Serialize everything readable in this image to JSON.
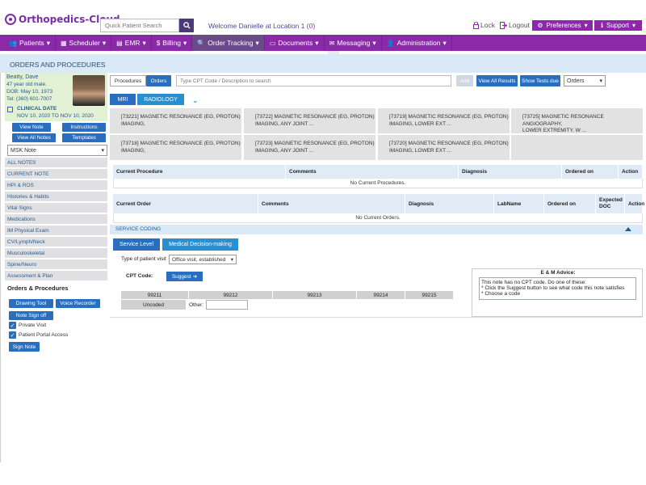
{
  "app": {
    "name": "Orthopedics-Cloud"
  },
  "header": {
    "search_placeholder": "Quick Patient Search",
    "welcome_prefix": "Welcome Danielle at Location 1 (",
    "welcome_count": "0",
    "welcome_suffix": ")",
    "lock_label": "Lock",
    "logout_label": "Logout",
    "preferences_label": "Preferences",
    "support_label": "Support"
  },
  "nav": {
    "items": [
      {
        "label": "Patients"
      },
      {
        "label": "Scheduler"
      },
      {
        "label": "EMR"
      },
      {
        "label": "Billing"
      },
      {
        "label": "Order Tracking"
      },
      {
        "label": "Documents"
      },
      {
        "label": "Messaging"
      },
      {
        "label": "Administration"
      }
    ]
  },
  "page": {
    "title": "ORDERS AND PROCEDURES"
  },
  "patient": {
    "name": "Beatty, Dave",
    "age_sex": "47 year old male.",
    "dob": "DOB: May 10, 1973",
    "tel": "Tel: (360) 601-7007",
    "clinical_date_label": "CLINICAL DATE",
    "clinical_dates": "NOV 10, 2020 TO NOV 10, 2020"
  },
  "left_panel": {
    "view_note": "View Note",
    "instructions": "Instructions",
    "view_all_notes": "View All Notes",
    "templates": "Templates",
    "note_select_value": "MSK Note",
    "note_items": [
      "ALL NOTES",
      "CURRENT NOTE",
      "HPI & ROS",
      "Histories & Habits",
      "Vital Signs",
      "Medications",
      "IM Physical Exam",
      "CV/Lymph/Neck",
      "Musculoskeletal",
      "Spine/Neuro",
      "Assessment & Plan"
    ],
    "orders_heading": "Orders & Procedures",
    "drawing_tool": "Drawing Tool",
    "voice_recorder": "Voice Recorder",
    "note_sign_off": "Note Sign off",
    "private_visit": "Private Visit",
    "patient_portal_access": "Patient Portal Access",
    "sign_note": "Sign Note"
  },
  "toolbar": {
    "procedures_tab": "Procedures",
    "orders_tab": "Orders",
    "cpt_placeholder": "Type CPT Code / Description to search",
    "add": "Add",
    "view_all_results": "View All Results",
    "show_tests_due": "Show Tests due",
    "order_type_value": "Orders"
  },
  "modality": {
    "mri": "MRI",
    "radiology": "RADIOLOGY"
  },
  "procedures": [
    {
      "line1": "[73221] MAGNETIC RESONANCE (EG, PROTON)",
      "line2": "IMAGING,"
    },
    {
      "line1": "[73722] MAGNETIC RESONANCE (EG, PROTON)",
      "line2": "IMAGING, ANY JOINT ..."
    },
    {
      "line1": "[73719] MAGNETIC RESONANCE (EG, PROTON)",
      "line2": "IMAGING, LOWER EXT ..."
    },
    {
      "line1": "[73725] MAGNETIC RESONANCE ANGIOGRAPHY,",
      "line2": "LOWER EXTREMITY, W ..."
    },
    {
      "line1": "[73718] MAGNETIC RESONANCE (EG, PROTON)",
      "line2": "IMAGING,"
    },
    {
      "line1": "[73723] MAGNETIC RESONANCE (EG, PROTON)",
      "line2": "IMAGING, ANY JOINT ..."
    },
    {
      "line1": "[73720] MAGNETIC RESONANCE (EG, PROTON)",
      "line2": "IMAGING, LOWER EXT ..."
    }
  ],
  "current_procedure_table": {
    "headers": [
      "Current Procedure",
      "Comments",
      "Diagnosis",
      "Ordered on",
      "Action"
    ],
    "empty": "No Current Procedures."
  },
  "current_order_table": {
    "headers": [
      "Current Order",
      "Comments",
      "Diagnosis",
      "LabName",
      "Ordered on",
      "Expected DOC",
      "Action"
    ],
    "empty": "No Current Orders."
  },
  "service_coding": {
    "title": "SERVICE CODING",
    "service_level_tab": "Service Level",
    "mdm_tab": "Medical Decision-making",
    "visit_label": "Type of patient visit",
    "visit_value": "Office visit, established",
    "cpt_label": "CPT Code:",
    "suggest": "Suggest",
    "codes": [
      "99211",
      "99212",
      "99213",
      "99214",
      "99215"
    ],
    "uncoded": "Uncoded",
    "other_label": "Other:",
    "em_title": "E & M Advice:",
    "em_lines": [
      "This note has no CPT code. Do one of these:",
      "* Click the Suggest button to see what code this note satisfies",
      "* Choose a code"
    ]
  }
}
